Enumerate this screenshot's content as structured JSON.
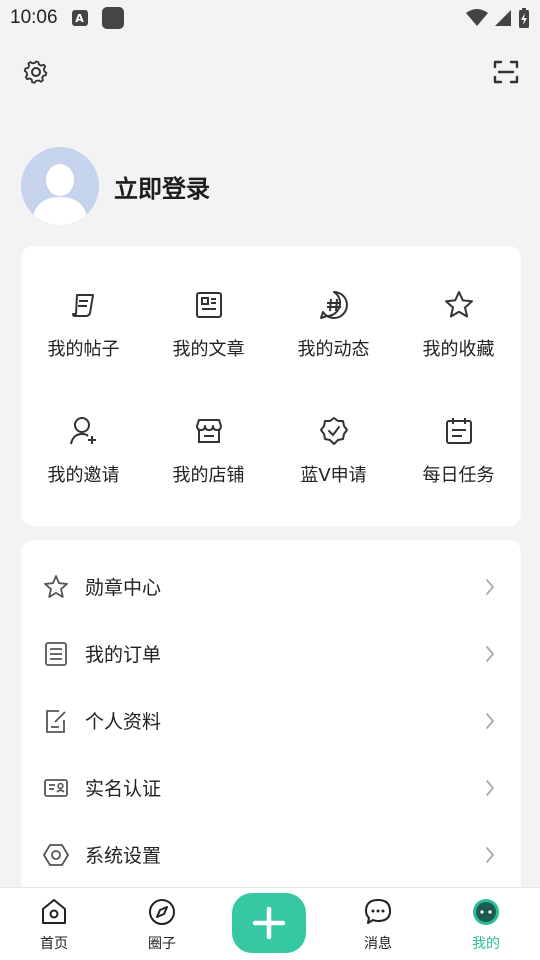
{
  "status": {
    "time": "10:06",
    "a_label": "A"
  },
  "profile": {
    "login_label": "立即登录"
  },
  "grid": {
    "items": [
      {
        "label": "我的帖子",
        "icon": "post-icon"
      },
      {
        "label": "我的文章",
        "icon": "article-icon"
      },
      {
        "label": "我的动态",
        "icon": "hashtag-icon"
      },
      {
        "label": "我的收藏",
        "icon": "star-icon"
      },
      {
        "label": "我的邀请",
        "icon": "invite-user-icon"
      },
      {
        "label": "我的店铺",
        "icon": "store-icon"
      },
      {
        "label": "蓝V申请",
        "icon": "verified-badge-icon"
      },
      {
        "label": "每日任务",
        "icon": "calendar-task-icon"
      }
    ]
  },
  "menu": {
    "items": [
      {
        "label": "勋章中心",
        "icon": "star-outline-icon"
      },
      {
        "label": "我的订单",
        "icon": "order-icon"
      },
      {
        "label": "个人资料",
        "icon": "edit-profile-icon"
      },
      {
        "label": "实名认证",
        "icon": "id-card-icon"
      },
      {
        "label": "系统设置",
        "icon": "hexagon-settings-icon"
      }
    ]
  },
  "tabs": [
    {
      "label": "首页",
      "icon": "home-icon"
    },
    {
      "label": "圈子",
      "icon": "compass-icon"
    },
    {
      "label": "消息",
      "icon": "chat-icon"
    },
    {
      "label": "我的",
      "icon": "me-face-icon"
    }
  ],
  "colors": {
    "accent": "#35c8a2",
    "active_tab": "#2bbd98",
    "background": "#f3f3f3"
  }
}
